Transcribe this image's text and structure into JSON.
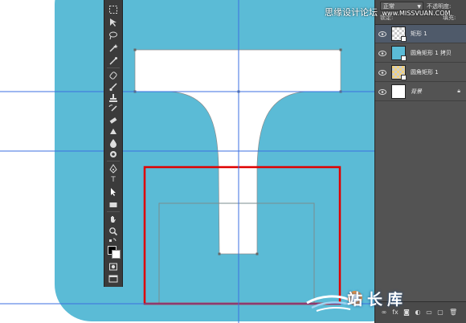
{
  "watermark": {
    "text": "思缘设计论坛",
    "site": "www.MISSVUAN.COM"
  },
  "layers_panel": {
    "blend_mode": "正常",
    "opacity_label": "不透明度:",
    "fill_label": "填充:",
    "lock_label": "锁定:",
    "layers": [
      {
        "name": "矩形 1",
        "thumb": "checker",
        "selected": true
      },
      {
        "name": "圆角矩形 1 拷贝",
        "thumb": "blue",
        "selected": false
      },
      {
        "name": "圆角矩形 1",
        "thumb": "yellow",
        "selected": false
      },
      {
        "name": "背景",
        "thumb": "white",
        "selected": false,
        "locked": true
      }
    ]
  },
  "tools": [
    "marquee-tool",
    "move-tool",
    "lasso-tool",
    "magic-wand-tool",
    "crop-tool",
    "eyedropper-tool",
    "healing-brush-tool",
    "brush-tool",
    "clone-stamp-tool",
    "history-brush-tool",
    "eraser-tool",
    "gradient-tool",
    "blur-tool",
    "dodge-tool",
    "pen-tool",
    "type-tool",
    "path-selection-tool",
    "rectangle-tool",
    "hand-tool",
    "zoom-tool"
  ],
  "type_tool_label": "T",
  "logo": {
    "text": "站长库"
  },
  "colors": {
    "canvas_blue": "#5bbbd6",
    "guide": "#3b6fe0",
    "selection_red": "#e00000",
    "shape_white": "#ffffff",
    "panel_bg": "#535353",
    "tools_bg": "#3b3b3b"
  }
}
